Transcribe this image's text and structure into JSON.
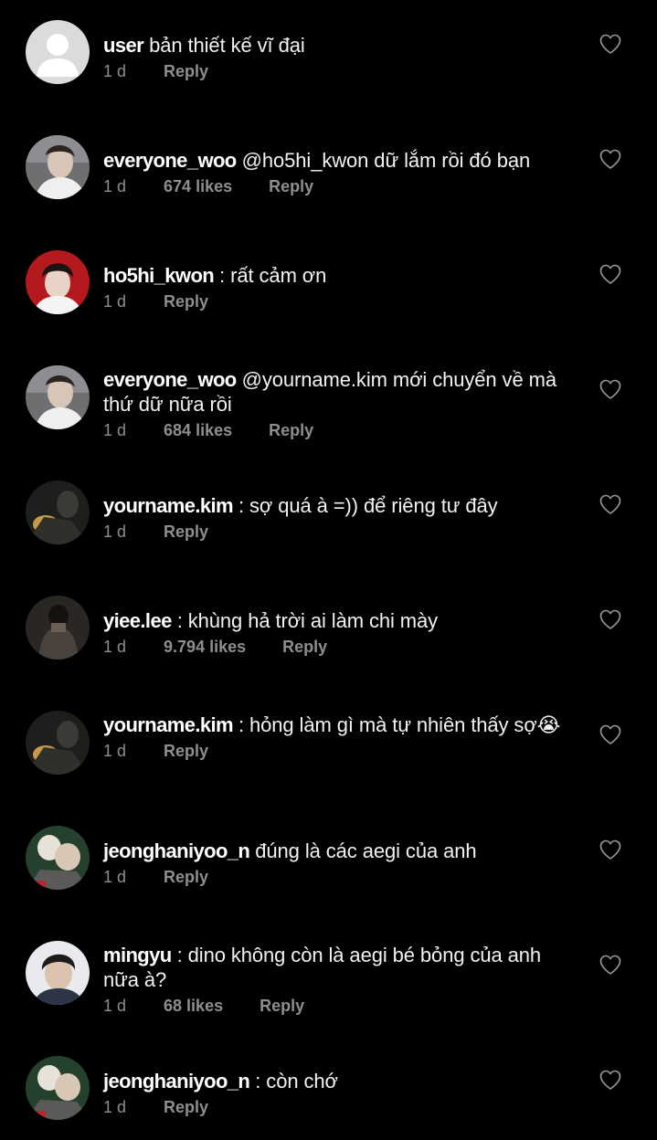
{
  "colors": {
    "background": "#000000",
    "text": "#f2f2f2",
    "muted": "#8e8e8e"
  },
  "comments": [
    {
      "username": "user",
      "text": "bản thiết kế vĩ đại",
      "time": "1 d",
      "likes": "",
      "reply_label": "Reply",
      "avatar": "default-user-avatar",
      "icon": "heart-outline-icon"
    },
    {
      "username": "everyone_woo",
      "text": "@ho5hi_kwon dữ lắm rồi đó bạn",
      "time": "1 d",
      "likes": "674 likes",
      "reply_label": "Reply",
      "avatar": "photo-avatar",
      "icon": "heart-outline-icon"
    },
    {
      "username": "ho5hi_kwon",
      "text": ": rất cảm ơn",
      "time": "1 d",
      "likes": "",
      "reply_label": "Reply",
      "avatar": "photo-avatar",
      "icon": "heart-outline-icon"
    },
    {
      "username": "everyone_woo",
      "text": "@yourname.kim mới chuyển về mà thứ dữ nữa rồi",
      "time": "1 d",
      "likes": "684 likes",
      "reply_label": "Reply",
      "avatar": "photo-avatar",
      "icon": "heart-outline-icon"
    },
    {
      "username": "yourname.kim",
      "text": ": sợ quá à =)) để riêng tư đây",
      "time": "1 d",
      "likes": "",
      "reply_label": "Reply",
      "avatar": "photo-avatar",
      "icon": "heart-outline-icon"
    },
    {
      "username": "yiee.lee",
      "text": ": khùng hả trời ai làm chi mày",
      "time": "1 d",
      "likes": "9.794 likes",
      "reply_label": "Reply",
      "avatar": "photo-avatar",
      "icon": "heart-outline-icon"
    },
    {
      "username": "yourname.kim",
      "text": ": hỏng làm gì mà tự nhiên thấy sợ😭",
      "time": "1 d",
      "likes": "",
      "reply_label": "Reply",
      "avatar": "photo-avatar",
      "icon": "heart-outline-icon"
    },
    {
      "username": "jeonghaniyoo_n",
      "text": "đúng là các aegi của anh",
      "time": "1 d",
      "likes": "",
      "reply_label": "Reply",
      "avatar": "photo-avatar",
      "icon": "heart-outline-icon"
    },
    {
      "username": "mingyu",
      "text": ": dino không còn là aegi bé bỏng của anh nữa à?",
      "time": "1 d",
      "likes": "68 likes",
      "reply_label": "Reply",
      "avatar": "photo-avatar",
      "icon": "heart-outline-icon"
    },
    {
      "username": "jeonghaniyoo_n",
      "text": ": còn chớ",
      "time": "1 d",
      "likes": "",
      "reply_label": "Reply",
      "avatar": "photo-avatar",
      "icon": "heart-outline-icon"
    }
  ]
}
